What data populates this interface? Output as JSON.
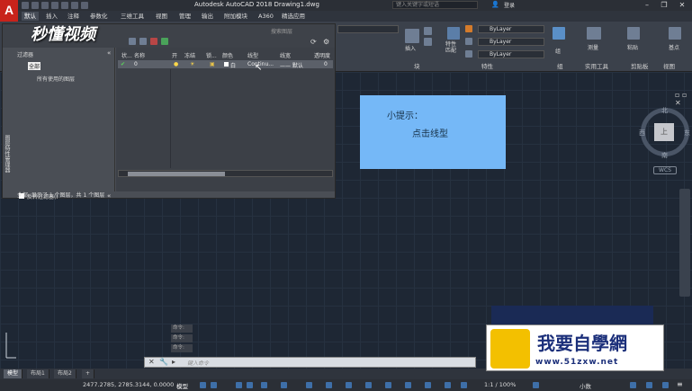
{
  "window": {
    "title": "Autodesk AutoCAD 2018    Drawing1.dwg",
    "search_placeholder": "键入关键字或短语",
    "user": "登录",
    "app_letter": "A"
  },
  "tabs": [
    "默认",
    "插入",
    "注释",
    "参数化",
    "三维工具",
    "视图",
    "管理",
    "输出",
    "附加模块",
    "A360",
    "精选应用"
  ],
  "ribbon": {
    "panel_labels": [
      "块",
      "特性",
      "组",
      "实用工具",
      "剪贴板",
      "视图"
    ],
    "insert_label": "插入",
    "match_label": "特性\n匹配",
    "group_label": "组",
    "measure_label": "测量",
    "paste_label": "粘贴",
    "base_label": "基点",
    "bylayer": [
      "ByLayer",
      "ByLayer",
      "ByLayer"
    ]
  },
  "layer_manager": {
    "search_placeholder": "搜索图层",
    "filters_label": "过滤器",
    "tree": [
      "全部",
      "所有使用的图层"
    ],
    "invert_filter": "反转过滤器(I",
    "columns": [
      "状...",
      "名称",
      "开",
      "冻结",
      "锁...",
      "颜色",
      "线型",
      "线宽",
      "透明度"
    ],
    "row": {
      "name": "0",
      "color": "白",
      "linetype": "Continu...",
      "lineweight": "—— 默认",
      "transparency": "0"
    },
    "status": "全部: 显示了 1 个图层，共 1 个图层",
    "side_label": "图层特性管理器"
  },
  "tip": {
    "title": "小提示：",
    "text": "点击线型"
  },
  "viewcube": {
    "north": "北",
    "south": "南",
    "west": "西",
    "east": "东",
    "face": "上",
    "wcs": "WCS"
  },
  "command": {
    "history": [
      "命令:",
      "命令:",
      "命令:"
    ],
    "placeholder": "键入命令"
  },
  "layout_tabs": [
    "模型",
    "布局1",
    "布局2",
    "+"
  ],
  "statusbar": {
    "coords": "2477.2785, 2785.3144, 0.0000",
    "model": "模型",
    "scale": "1:1 / 100%",
    "units": "小数"
  },
  "watermarks": {
    "top": "秒懂视频",
    "bottom_title": "我要自學網",
    "bottom_url": "www.51zxw.net"
  },
  "colors": {
    "tip_bg": "#75b8f7",
    "canvas": "#1e2734",
    "logo": "#c8231b"
  }
}
